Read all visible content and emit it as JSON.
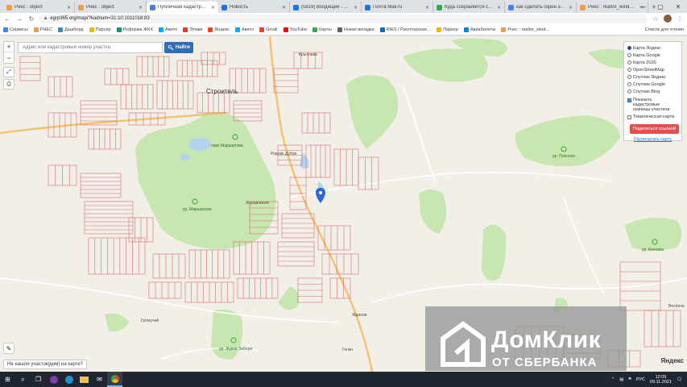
{
  "browser": {
    "tabs": [
      {
        "title": "Рнес : object",
        "color": "#e8a04a"
      },
      {
        "title": "Рнес : object",
        "color": "#e8a04a"
      },
      {
        "title": "Публичная кадастрован…",
        "color": "#4a7fd8",
        "active": true
      },
      {
        "title": "Новость",
        "color": "#1a73e8"
      },
      {
        "title": "(5819) Входящие - Почта…",
        "color": "#1a73e8"
      },
      {
        "title": "Почта Mail.ru",
        "color": "#1a73e8"
      },
      {
        "title": "Куда сохраняется скрин…",
        "color": "#34a853"
      },
      {
        "title": "как сделать скрин экрана…",
        "color": "#4285f4"
      },
      {
        "title": "Рнес : realtor_wind…",
        "color": "#e8a04a"
      }
    ],
    "new_tab_label": "+",
    "url": "egrp365.org/map/?kadnum=31:10:1011018:83",
    "bookmarks": [
      {
        "label": "Сервисы",
        "color": "#4285f4"
      },
      {
        "label": "РНЕС",
        "color": "#e8a04a"
      },
      {
        "label": "Дашборд",
        "color": "#3c8dbc"
      },
      {
        "label": "Парсер",
        "color": "#f4b400"
      },
      {
        "label": "Реформа ЖКХ",
        "color": "#0f9d58"
      },
      {
        "label": "Авито",
        "color": "#00aaff"
      },
      {
        "label": "Этажи",
        "color": "#e53935"
      },
      {
        "label": "Яндекс",
        "color": "#fc3f1d"
      },
      {
        "label": "Авито",
        "color": "#00aaff"
      },
      {
        "label": "Gmail",
        "color": "#ea4335"
      },
      {
        "label": "YouTube",
        "color": "#ff0000"
      },
      {
        "label": "Карты",
        "color": "#34a853"
      },
      {
        "label": "Новая вкладка",
        "color": "#5f6368"
      },
      {
        "label": "RIES / Риэлторская…",
        "color": "#1565c0"
      },
      {
        "label": "Паркер",
        "color": "#f4b400"
      },
      {
        "label": "Авиабилеты",
        "color": "#0288d1"
      },
      {
        "label": "Рнес : realtor_wind…",
        "color": "#e8a04a"
      }
    ],
    "reading_list": "Список для чтения"
  },
  "map": {
    "search": {
      "placeholder": "Адрес или кадастровый номер участка",
      "button_label": "Найти"
    },
    "zoom_in": "+",
    "zoom_out": "−",
    "layers": {
      "base_maps": [
        {
          "label": "Карта Яндекс",
          "selected": true
        },
        {
          "label": "Карта Google",
          "selected": false
        },
        {
          "label": "Карта 2GIS",
          "selected": false
        },
        {
          "label": "OpenStreetMap",
          "selected": false
        },
        {
          "label": "Спутник Яндекс",
          "selected": false
        },
        {
          "label": "Спутник Google",
          "selected": false
        },
        {
          "label": "Спутник Bing",
          "selected": false
        }
      ],
      "cadastral_label": "Показать кадастровые границы участков",
      "cadastral_checked": true,
      "thematic_label": "Тематическая карта",
      "thematic_checked": false,
      "share_button": "Поделиться ссылкой",
      "print_link": "Распечатать карту"
    },
    "labels": {
      "stroitel": "Строитель",
      "zhuravlinoe": "Журавлиное",
      "rodnik_dubov": "Родник Дубов",
      "gremuchiy": "Гремучий",
      "zhdanov": "Жданов",
      "gonki": "Гонки",
      "park_marshala": "парк Маршалова",
      "ur_marshala": "ур. Маршалова",
      "ur_plesnoe": "ур. Плесное",
      "ur_konchaka": "ур. Кончака",
      "ur_zhuravlinoe": "ур. Жуков Забора",
      "krylovka": "Крыловка",
      "veseloe": "Весёлое"
    },
    "not_found_label": "Не нашли участок(дом) на карте?",
    "yandex_mark": "Яндекс",
    "watermark": {
      "line1": "ДомКлик",
      "line2": "ОТ СБЕРБАНКА"
    }
  },
  "taskbar": {
    "language": "РУС",
    "time": "12:09",
    "date": "09.11.2021"
  }
}
